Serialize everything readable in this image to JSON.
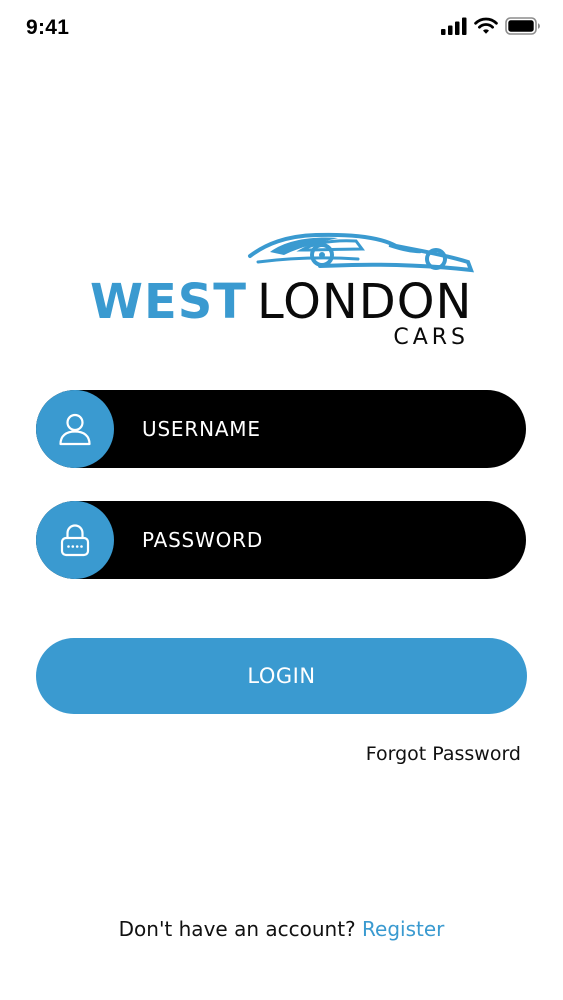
{
  "status_bar": {
    "time": "9:41"
  },
  "logo": {
    "word1": "WEST",
    "word2": "LONDON",
    "word3": "CARS",
    "icon": "car-silhouette-icon",
    "colors": {
      "accent": "#3a9ad0",
      "dark": "#0a0a0a"
    }
  },
  "form": {
    "username": {
      "placeholder": "USERNAME",
      "value": "",
      "icon": "user-icon"
    },
    "password": {
      "placeholder": "PASSWORD",
      "value": "",
      "icon": "lock-icon"
    },
    "login_label": "LOGIN",
    "forgot_label": "Forgot Password"
  },
  "footer": {
    "prompt": "Don't have an account?",
    "register_label": "Register"
  },
  "colors": {
    "primary": "#3a9ad0",
    "field_background": "#000000",
    "background": "#ffffff"
  }
}
